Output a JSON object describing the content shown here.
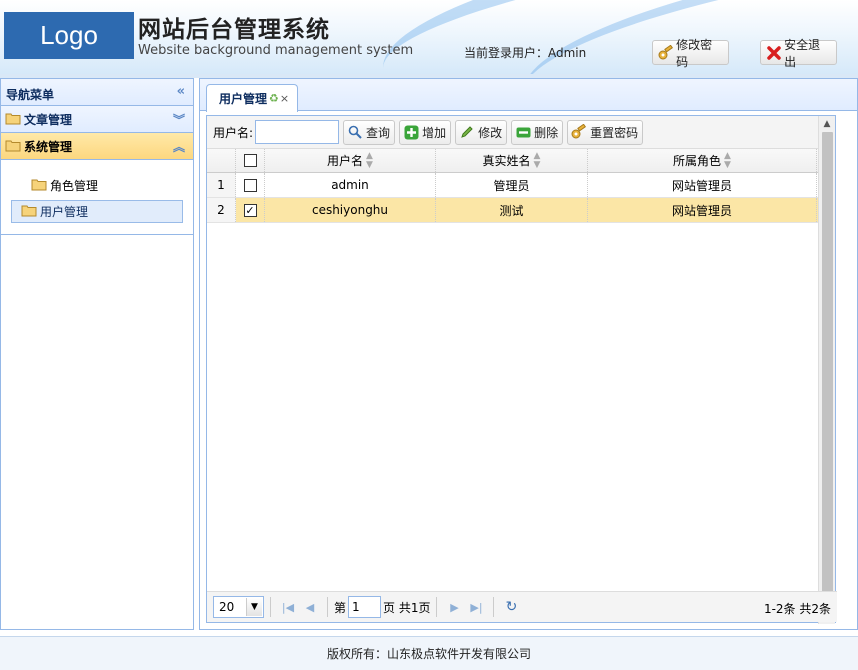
{
  "header": {
    "logo": "Logo",
    "title": "网站后台管理系统",
    "subtitle": "Website background management system",
    "login_user": "当前登录用户：Admin",
    "change_password_label": "修改密码",
    "logout_label": "安全退出"
  },
  "sidebar": {
    "title": "导航菜单",
    "groups": [
      {
        "label": "文章管理",
        "expanded": false
      },
      {
        "label": "系统管理",
        "expanded": true,
        "items": [
          {
            "label": "角色管理"
          },
          {
            "label": "用户管理"
          }
        ]
      }
    ]
  },
  "tabs": [
    {
      "label": "用户管理"
    }
  ],
  "toolbar": {
    "username_label": "用户名:",
    "username_value": "",
    "query_label": "查询",
    "add_label": "增加",
    "edit_label": "修改",
    "delete_label": "删除",
    "reset_password_label": "重置密码"
  },
  "table": {
    "columns": [
      "用户名",
      "真实姓名",
      "所属角色"
    ],
    "rows": [
      {
        "num": "1",
        "checked": false,
        "username": "admin",
        "realname": "管理员",
        "role": "网站管理员"
      },
      {
        "num": "2",
        "checked": true,
        "username": "ceshiyonghu",
        "realname": "测试",
        "role": "网站管理员"
      }
    ]
  },
  "pager": {
    "page_size": "20",
    "page_prefix": "第",
    "page_value": "1",
    "page_suffix": "页 共1页",
    "info": "1-2条 共2条"
  },
  "footer": {
    "copyright": "版权所有：山东极点软件开发有限公司"
  },
  "colors": {
    "accent": "#95b8e7",
    "selected_row": "#fbe6a6",
    "logo_bg": "#2d6ab0"
  }
}
